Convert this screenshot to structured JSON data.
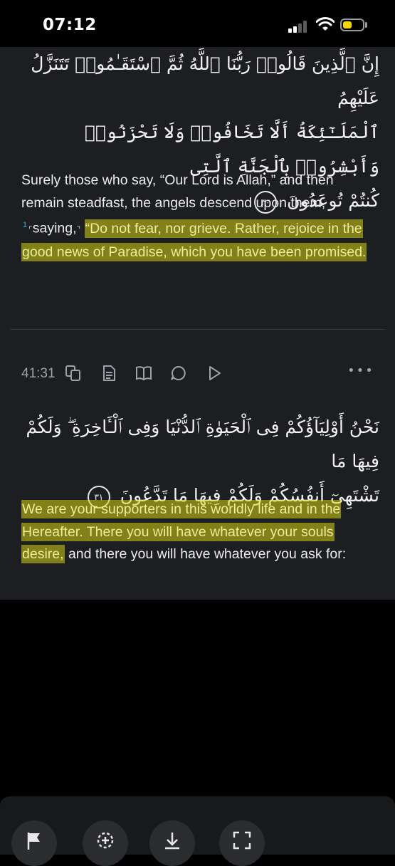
{
  "status_bar": {
    "time": "07:12"
  },
  "verse_30": {
    "arabic_lines": [
      "إِنَّ ٱلَّذِينَ قَالُوا۟ رَبُّنَا ٱللَّهُ ثُمَّ ٱسْتَقَـٰمُوا۟ تَتَنَزَّلُ عَلَيْهِمُ",
      "ٱلْمَلَـٰٓئِكَةُ أَلَّا تَخَافُوا۟ وَلَا تَحْزَنُوا۟ وَأَبْشِرُوا۟ بِٱلْجَنَّةِ ٱلَّتِى",
      "كُنتُمْ تُوعَدُونَ"
    ],
    "number": "٣٠",
    "translation": {
      "part1": "Surely those who say, “Our Lord is Allah,” and then remain steadfast, the angels descend upon them,",
      "footnote": "1",
      "part2": "saying,",
      "highlight": "“Do not fear, nor grieve. Rather, rejoice in the good news of Paradise, which you have been promised."
    }
  },
  "toolbar": {
    "reference": "41:31",
    "icons": [
      "copy-icon",
      "tafsir-icon",
      "book-icon",
      "comment-icon",
      "play-icon",
      "more-icon"
    ],
    "more": "•••"
  },
  "verse_31": {
    "arabic_lines": [
      "نَحْنُ أَوْلِيَآؤُكُمْ فِى ٱلْحَيَوٰةِ ٱلدُّنْيَا وَفِى ٱلْـَٔاخِرَةِ ۖ وَلَكُمْ فِيهَا مَا",
      "تَشْتَهِىٓ أَنفُسُكُمْ وَلَكُمْ فِيهَا مَا تَدَّعُونَ"
    ],
    "number": "٣١",
    "translation": {
      "highlight": "We are your supporters in this worldly life and in the Hereafter. There you will have whatever your souls desire,",
      "rest": "and there you will have whatever you ask for:"
    }
  },
  "bottom_bar": {
    "icons": [
      "flag-icon",
      "add-bookmark-icon",
      "download-icon",
      "fullscreen-icon"
    ]
  },
  "colors": {
    "highlight": "#d7d214",
    "link": "#3fa9d6",
    "background": "#1c1e21"
  }
}
